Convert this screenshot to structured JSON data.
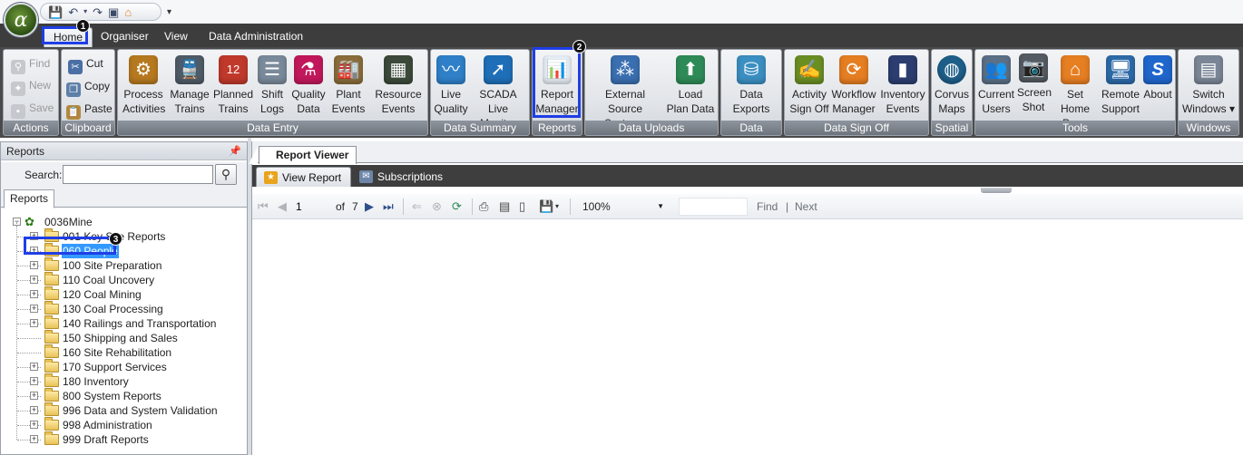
{
  "app": {
    "logo_glyph": "α"
  },
  "quick_access": {
    "icons": [
      "save-icon",
      "undo-icon",
      "redo-icon",
      "screenshot-icon",
      "home-icon"
    ]
  },
  "menu_tabs": [
    {
      "label": "Home",
      "active": true
    },
    {
      "label": "Organiser",
      "active": false
    },
    {
      "label": "View",
      "active": false
    },
    {
      "label": "Data Administration",
      "active": false
    }
  ],
  "annotations": [
    "1",
    "2",
    "3"
  ],
  "ribbon": {
    "actions": {
      "label": "Actions",
      "find": "Find",
      "new": "New",
      "save": "Save"
    },
    "clipboard": {
      "label": "Clipboard",
      "cut": "Cut",
      "copy": "Copy",
      "paste": "Paste"
    },
    "data_entry": {
      "label": "Data Entry",
      "buttons": [
        {
          "l1": "Process",
          "l2": "Activities",
          "color": "#b7791f",
          "glyph": "⚙"
        },
        {
          "l1": "Manage",
          "l2": "Trains",
          "color": "#4f5b68",
          "glyph": "🚆"
        },
        {
          "l1": "Planned",
          "l2": "Trains",
          "color": "#c0392b",
          "glyph": "12"
        },
        {
          "l1": "Shift",
          "l2": "Logs",
          "color": "#7a8a9a",
          "glyph": "☰"
        },
        {
          "l1": "Quality",
          "l2": "Data",
          "color": "#c2185b",
          "glyph": "⚗"
        },
        {
          "l1": "Plant",
          "l2": "Events",
          "color": "#8a6d3b",
          "glyph": "🏭"
        },
        {
          "l1": "Resource",
          "l2": "Events",
          "color": "#3c4a3a",
          "glyph": "▦"
        }
      ]
    },
    "data_summary": {
      "label": "Data Summary",
      "buttons": [
        {
          "l1": "Live",
          "l2": "Quality",
          "color": "#2f80c9",
          "glyph": "〰"
        },
        {
          "l1": "SCADA",
          "l2": "Live Monitor",
          "color": "#1f6fb8",
          "glyph": "➚"
        }
      ]
    },
    "reports": {
      "label": "Reports",
      "button": {
        "l1": "Report",
        "l2": "Manager",
        "color": "#e8eef5",
        "glyph": "📊"
      }
    },
    "data_uploads": {
      "label": "Data Uploads",
      "buttons": [
        {
          "l1": "External Source",
          "l2": "Systems",
          "color": "#3a6fb0",
          "glyph": "⁂"
        },
        {
          "l1": "Load",
          "l2": "Plan Data",
          "color": "#2e8b57",
          "glyph": "⬆"
        }
      ]
    },
    "data_exports": {
      "label": "Data Exports",
      "button": {
        "l1": "Data",
        "l2": "Exports",
        "color": "#3b8fc2",
        "glyph": "⛁"
      }
    },
    "data_sign_off": {
      "label": "Data Sign Off",
      "buttons": [
        {
          "l1": "Activity",
          "l2": "Sign Off",
          "color": "#6b8e23",
          "glyph": "✍"
        },
        {
          "l1": "Workflow",
          "l2": "Manager",
          "color": "#e67e22",
          "glyph": "⟳"
        },
        {
          "l1": "Inventory",
          "l2": "Events",
          "color": "#2c3e70",
          "glyph": "▮"
        }
      ]
    },
    "spatial": {
      "label": "Spatial",
      "button": {
        "l1": "Corvus",
        "l2": "Maps",
        "color": "#1e5f8a",
        "glyph": "◍"
      }
    },
    "tools": {
      "label": "Tools",
      "buttons": [
        {
          "l1": "Current",
          "l2": "Users",
          "color": "#5b6f86",
          "glyph": "👥"
        },
        {
          "l1": "Screen",
          "l2": "Shot",
          "color": "#555b63",
          "glyph": "📷"
        },
        {
          "l1": "Set Home",
          "l2": "Page",
          "color": "#e67e22",
          "glyph": "⌂"
        },
        {
          "l1": "Remote",
          "l2": "Support",
          "color": "#2d6aa8",
          "glyph": "🖥"
        },
        {
          "l1": "About",
          "l2": "",
          "color": "#1f66cc",
          "glyph": "S"
        }
      ]
    },
    "windows": {
      "label": "Windows",
      "button": {
        "l1": "Switch",
        "l2": "Windows ▾",
        "color": "#7a8696",
        "glyph": "▤"
      }
    }
  },
  "left_panel": {
    "title": "Reports",
    "search_label": "Search:",
    "search_value": "",
    "tab": "Reports",
    "root": "0036Mine",
    "items": [
      {
        "label": "001 Key Site Reports",
        "expandable": true,
        "selected": false
      },
      {
        "label": "060 People",
        "expandable": true,
        "selected": true
      },
      {
        "label": "100 Site Preparation",
        "expandable": true,
        "selected": false
      },
      {
        "label": "110 Coal Uncovery",
        "expandable": true,
        "selected": false
      },
      {
        "label": "120 Coal Mining",
        "expandable": true,
        "selected": false
      },
      {
        "label": "130 Coal Processing",
        "expandable": true,
        "selected": false
      },
      {
        "label": "140 Railings and Transportation",
        "expandable": true,
        "selected": false
      },
      {
        "label": "150 Shipping and Sales",
        "expandable": false,
        "selected": false
      },
      {
        "label": "160 Site Rehabilitation",
        "expandable": false,
        "selected": false
      },
      {
        "label": "170 Support Services",
        "expandable": true,
        "selected": false
      },
      {
        "label": "180 Inventory",
        "expandable": true,
        "selected": false
      },
      {
        "label": "800 System Reports",
        "expandable": true,
        "selected": false
      },
      {
        "label": "996 Data and System Validation",
        "expandable": true,
        "selected": false
      },
      {
        "label": "998 Administration",
        "expandable": true,
        "selected": false
      },
      {
        "label": "999 Draft Reports",
        "expandable": true,
        "selected": false
      }
    ]
  },
  "document": {
    "tab": "Report Viewer",
    "viewer_tabs": [
      {
        "label": "View Report",
        "active": true
      },
      {
        "label": "Subscriptions",
        "active": false
      }
    ],
    "toolbar": {
      "page_value": "1",
      "of_label": "of",
      "total_pages": "7",
      "zoom": "100%",
      "find_value": "",
      "find_label": "Find",
      "sep_label": "|",
      "next_label": "Next"
    }
  }
}
